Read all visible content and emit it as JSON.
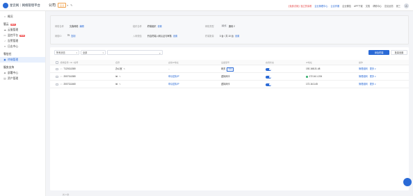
{
  "header": {
    "logo_text": "星云网｜网络管理平台",
    "workspace_name": "公司",
    "workspace_tag": "企业",
    "links": [
      "【免费试用】独立的易看",
      "企业管理中心",
      "云合作服",
      "企业微信",
      "APP下载",
      "文档",
      "帮助中心",
      "意见反馈",
      "张三"
    ],
    "avatar_letter": "A"
  },
  "sidebar": {
    "items_top": [
      {
        "label": "概况",
        "icon": "home-icon"
      }
    ],
    "group1": {
      "label": "管云",
      "badge": "NEW"
    },
    "items_mid": [
      {
        "label": "云服管理",
        "icon": "cloud-icon"
      },
      {
        "label": "监控平台",
        "icon": "monitor-icon",
        "badge": "NEW"
      },
      {
        "label": "告警管理",
        "icon": "bell-icon"
      },
      {
        "label": "日志中心",
        "icon": "log-icon"
      }
    ],
    "group2": {
      "label": "零信任"
    },
    "items_zt": [
      {
        "label": "终端管理",
        "icon": "terminal-icon",
        "active": true
      }
    ],
    "group3": {
      "label": "服务支持"
    },
    "items_bottom": [
      {
        "label": "部署中心",
        "icon": "deploy-icon"
      },
      {
        "label": "资产管理",
        "icon": "asset-icon"
      }
    ]
  },
  "info": {
    "row1": [
      {
        "label": "网络名称",
        "value": "文森网络",
        "link": "编辑"
      },
      {
        "label": "组织名称",
        "value": "终端组织",
        "link": "设置"
      },
      {
        "label": "网络类型",
        "value": "通用 2",
        "tag": "模式"
      }
    ],
    "row2": [
      {
        "label": "网络ID",
        "value": "79",
        "link": "复制"
      },
      {
        "label": "入网校验",
        "value": "开启终端入网认证与审核",
        "link": "设置"
      },
      {
        "label": "终端数量",
        "value": "3 台 / 共 10 台",
        "link": "设置"
      }
    ]
  },
  "toolbar": {
    "filter_label": "所有状态",
    "type_label": "全部",
    "search_placeholder": "",
    "primary_button": "添加终端",
    "secondary_button": "批量设置"
  },
  "table": {
    "headers": [
      "终端名称 / ID / 编号",
      "名称",
      "虚拟IP地址",
      "设备型号",
      "启用状态",
      "IP地址",
      "操作"
    ],
    "rows": [
      {
        "id": "7120111380",
        "name": "办公室",
        "vip": "--",
        "model": "网关",
        "model_badge": "主机",
        "enabled": true,
        "ip": "192.168.31.48",
        "online": false,
        "actions": [
          "管理组网",
          "更多"
        ]
      },
      {
        "id": "2007111380",
        "name": "ist",
        "vip": "申请虚拟IP",
        "model": "虚拟网卡",
        "model_badge": "",
        "enabled": true,
        "ip": "172.16.1.224",
        "online": true,
        "actions": [
          "管理组网",
          "更多"
        ]
      },
      {
        "id": "2007111460",
        "name": "ist",
        "vip": "申请虚拟IP",
        "model": "虚拟网卡",
        "model_badge": "",
        "enabled": true,
        "ip": "172.16.3.45",
        "online": false,
        "actions": [
          "管理组网",
          "更多"
        ]
      }
    ]
  },
  "footer": {
    "text": "共 3 条"
  },
  "colors": {
    "accent": "#2a6ad6",
    "sidebar_active_bg": "#e8f0fd",
    "page_bg": "#f3f4f7",
    "danger": "#e54545"
  }
}
